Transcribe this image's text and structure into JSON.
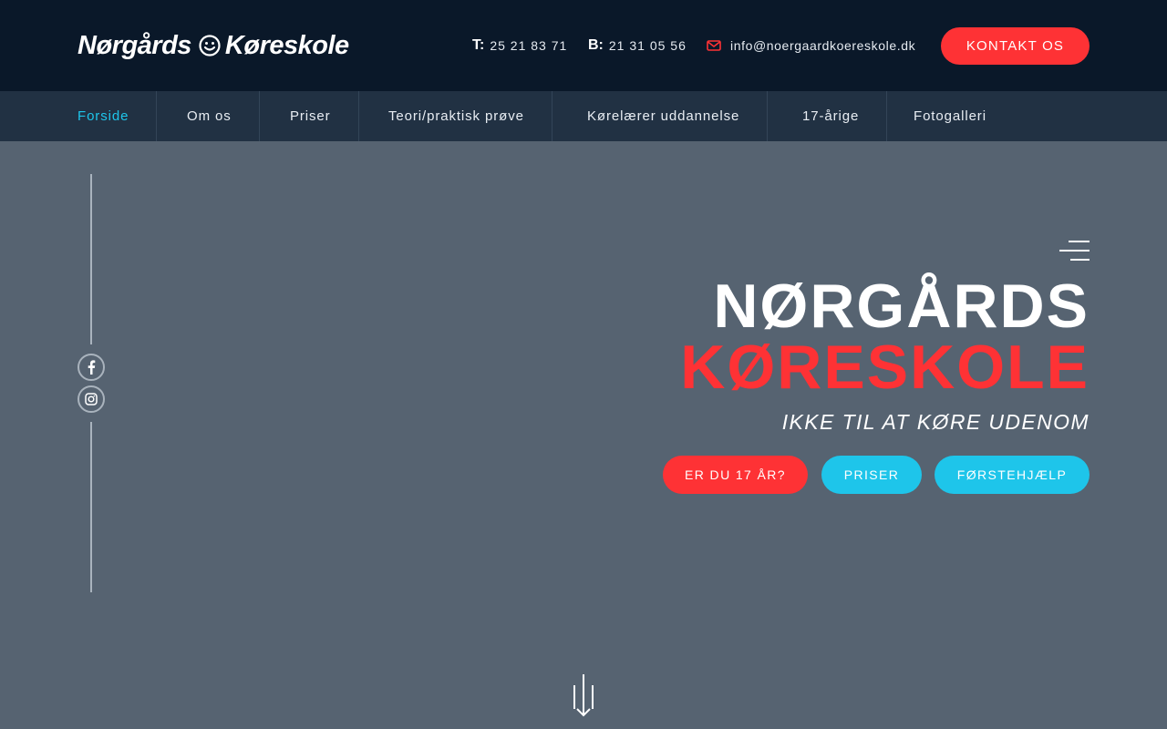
{
  "header": {
    "logo_text_1": "Nørgårds",
    "logo_text_2": "Køreskole",
    "phone_label": "T:",
    "phone_value": "25 21 83 71",
    "mobile_label": "B:",
    "mobile_value": "21 31 05 56",
    "email": "info@noergaardkoereskole.dk",
    "contact_button": "KONTAKT OS"
  },
  "nav": {
    "items": [
      {
        "label": "Forside",
        "active": true
      },
      {
        "label": "Om os"
      },
      {
        "label": "Priser"
      },
      {
        "label": "Teori/praktisk prøve"
      },
      {
        "label": "Kørelærer uddannelse"
      },
      {
        "label": "17-årige"
      },
      {
        "label": "Fotogalleri"
      }
    ]
  },
  "hero": {
    "title_line_1": "NØRGÅRDS",
    "title_line_2": "KØRESKOLE",
    "subtitle": "IKKE TIL AT KØRE UDENOM",
    "buttons": {
      "age17": "ER DU 17 ÅR?",
      "priser": "PRISER",
      "first_aid": "FØRSTEHJÆLP"
    }
  },
  "social": {
    "icons": [
      "facebook-icon",
      "instagram-icon"
    ]
  },
  "colors": {
    "header_bg": "#0a1829",
    "nav_bg": "#213143",
    "hero_bg": "#566371",
    "accent_red": "#fe3235",
    "accent_cyan": "#1ec5ea"
  }
}
